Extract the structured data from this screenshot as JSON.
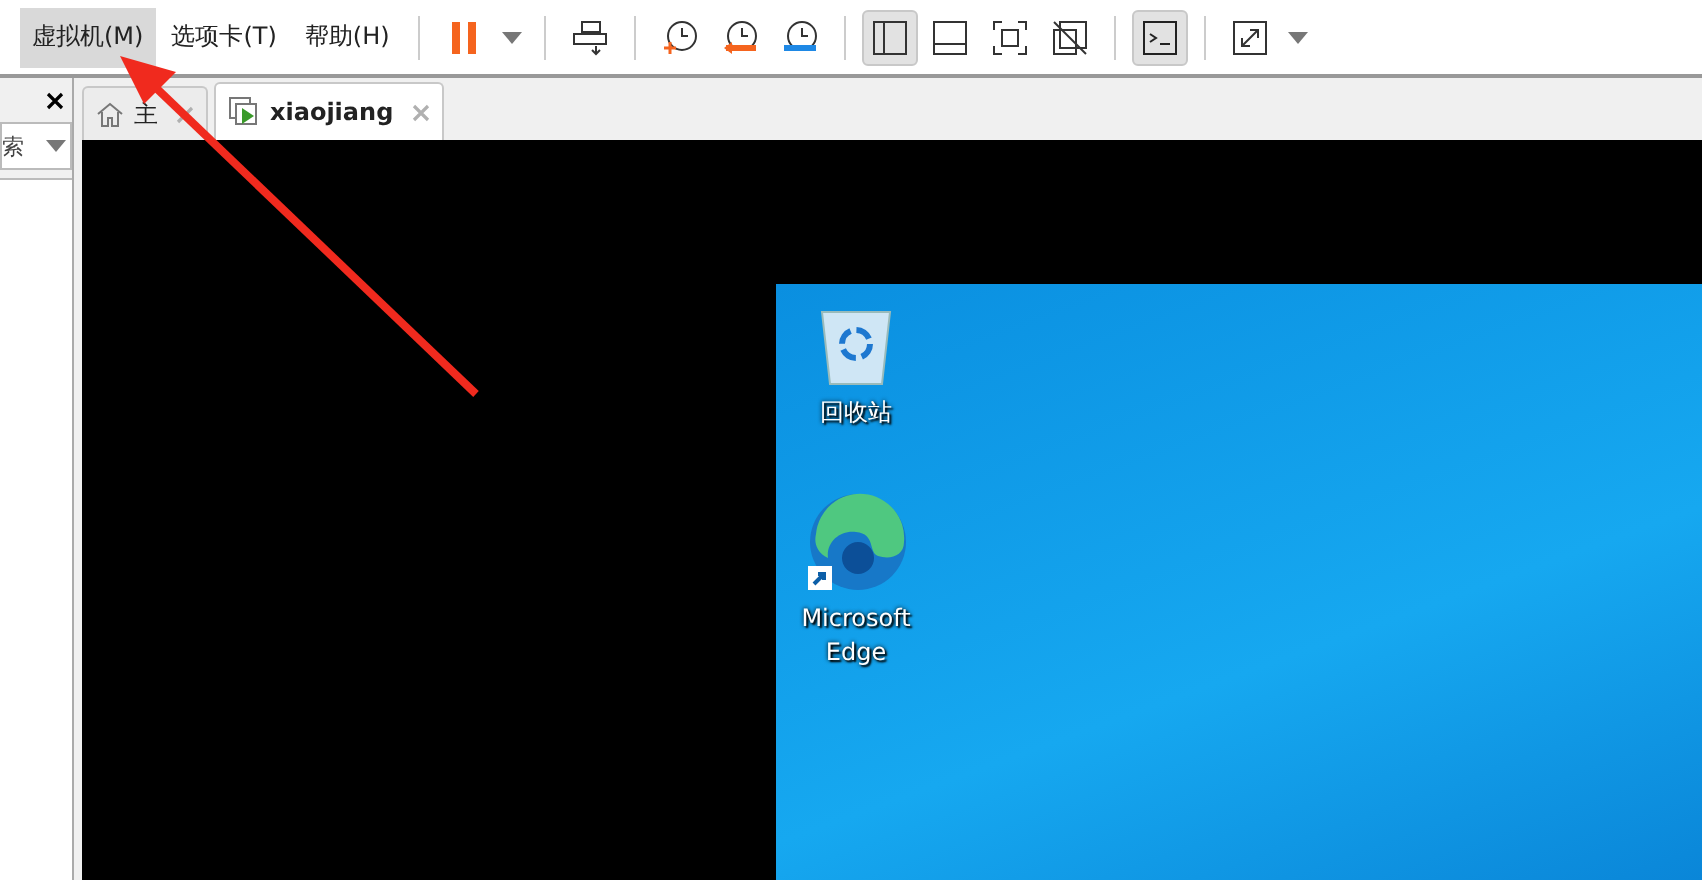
{
  "menu": [
    {
      "label": "虚拟机(M)",
      "selected": true
    },
    {
      "label": "选项卡(T)",
      "selected": false
    },
    {
      "label": "帮助(H)",
      "selected": false
    }
  ],
  "toolbar": [
    {
      "buttons": [
        {
          "kind": "pause"
        },
        {
          "kind": "caret"
        }
      ]
    },
    {
      "buttons": [
        {
          "kind": "sendkeys"
        }
      ]
    },
    {
      "buttons": [
        {
          "kind": "snap-take"
        },
        {
          "kind": "snap-revert"
        },
        {
          "kind": "snap-manage"
        }
      ]
    },
    {
      "buttons": [
        {
          "kind": "view-library",
          "selected": true
        },
        {
          "kind": "view-thumbs",
          "selected": false
        },
        {
          "kind": "view-full",
          "selected": false
        },
        {
          "kind": "view-unity",
          "selected": false
        }
      ]
    },
    {
      "buttons": [
        {
          "kind": "console",
          "selected": true
        }
      ]
    },
    {
      "buttons": [
        {
          "kind": "stretch"
        },
        {
          "kind": "caret"
        }
      ]
    }
  ],
  "sidebar": {
    "search": "索"
  },
  "tabs": [
    {
      "label": "主",
      "kind": "home",
      "selected": false
    },
    {
      "label": "xiaojiang",
      "kind": "vm",
      "selected": true
    }
  ],
  "desktop": {
    "icons": [
      {
        "kind": "recycle",
        "label": "回收站"
      },
      {
        "kind": "edge",
        "label": "Microsoft Edge"
      }
    ]
  }
}
